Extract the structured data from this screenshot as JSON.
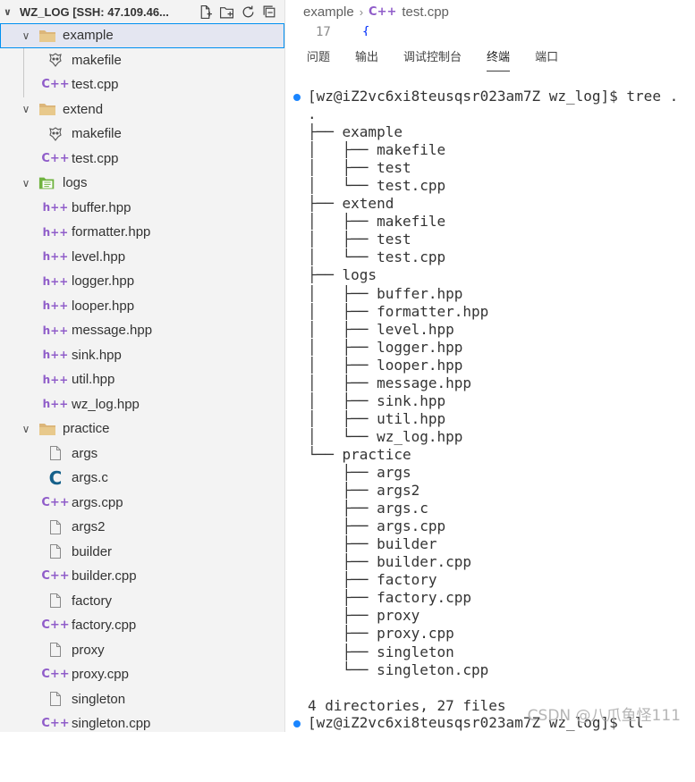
{
  "explorer": {
    "title": "WZ_LOG [SSH: 47.109.46...",
    "rows": [
      {
        "label": "example",
        "type": "folder",
        "depth": 0,
        "expanded": true,
        "selected": true
      },
      {
        "label": "makefile",
        "type": "makefile",
        "depth": 1
      },
      {
        "label": "test.cpp",
        "type": "cpp",
        "depth": 1
      },
      {
        "label": "extend",
        "type": "folder",
        "depth": 0,
        "expanded": true
      },
      {
        "label": "makefile",
        "type": "makefile",
        "depth": 1
      },
      {
        "label": "test.cpp",
        "type": "cpp",
        "depth": 1
      },
      {
        "label": "logs",
        "type": "folder-logs",
        "depth": 0,
        "expanded": true
      },
      {
        "label": "buffer.hpp",
        "type": "hpp",
        "depth": 1
      },
      {
        "label": "formatter.hpp",
        "type": "hpp",
        "depth": 1
      },
      {
        "label": "level.hpp",
        "type": "hpp",
        "depth": 1
      },
      {
        "label": "logger.hpp",
        "type": "hpp",
        "depth": 1
      },
      {
        "label": "looper.hpp",
        "type": "hpp",
        "depth": 1
      },
      {
        "label": "message.hpp",
        "type": "hpp",
        "depth": 1
      },
      {
        "label": "sink.hpp",
        "type": "hpp",
        "depth": 1
      },
      {
        "label": "util.hpp",
        "type": "hpp",
        "depth": 1
      },
      {
        "label": "wz_log.hpp",
        "type": "hpp",
        "depth": 1
      },
      {
        "label": "practice",
        "type": "folder",
        "depth": 0,
        "expanded": true
      },
      {
        "label": "args",
        "type": "file",
        "depth": 1
      },
      {
        "label": "args.c",
        "type": "c",
        "depth": 1
      },
      {
        "label": "args.cpp",
        "type": "cpp",
        "depth": 1
      },
      {
        "label": "args2",
        "type": "file",
        "depth": 1
      },
      {
        "label": "builder",
        "type": "file",
        "depth": 1
      },
      {
        "label": "builder.cpp",
        "type": "cpp",
        "depth": 1
      },
      {
        "label": "factory",
        "type": "file",
        "depth": 1
      },
      {
        "label": "factory.cpp",
        "type": "cpp",
        "depth": 1
      },
      {
        "label": "proxy",
        "type": "file",
        "depth": 1
      },
      {
        "label": "proxy.cpp",
        "type": "cpp",
        "depth": 1
      },
      {
        "label": "singleton",
        "type": "file",
        "depth": 1
      },
      {
        "label": "singleton.cpp",
        "type": "cpp",
        "depth": 1
      }
    ],
    "icon_glyphs": {
      "cpp": "C++",
      "hpp": "h++",
      "c": "C"
    }
  },
  "breadcrumb": {
    "folder": "example",
    "file": "test.cpp"
  },
  "editor_peek": {
    "line_number": "17",
    "text": "{"
  },
  "panel_tabs": [
    "问题",
    "输出",
    "调试控制台",
    "终端",
    "端口"
  ],
  "active_tab_index": 3,
  "terminal": {
    "prompt1": "[wz@iZ2vc6xi8teusqsr023am7Z wz_log]$ tree .",
    "lines": [
      ".",
      "├── example",
      "│   ├── makefile",
      "│   ├── test",
      "│   └── test.cpp",
      "├── extend",
      "│   ├── makefile",
      "│   ├── test",
      "│   └── test.cpp",
      "├── logs",
      "│   ├── buffer.hpp",
      "│   ├── formatter.hpp",
      "│   ├── level.hpp",
      "│   ├── logger.hpp",
      "│   ├── looper.hpp",
      "│   ├── message.hpp",
      "│   ├── sink.hpp",
      "│   ├── util.hpp",
      "│   └── wz_log.hpp",
      "└── practice",
      "    ├── args",
      "    ├── args2",
      "    ├── args.c",
      "    ├── args.cpp",
      "    ├── builder",
      "    ├── builder.cpp",
      "    ├── factory",
      "    ├── factory.cpp",
      "    ├── proxy",
      "    ├── proxy.cpp",
      "    ├── singleton",
      "    └── singleton.cpp",
      "",
      "4 directories, 27 files"
    ],
    "prompt2": "[wz@iZ2vc6xi8teusqsr023am7Z wz_log]$ ll"
  },
  "watermark": "CSDN @八爪鱼怪111",
  "colors": {
    "accent": "#0090f1",
    "cpp_icon": "#8f5cc9",
    "c_icon": "#15608a",
    "prompt_dot": "#1a85ff",
    "folder": "#dcb67a"
  }
}
